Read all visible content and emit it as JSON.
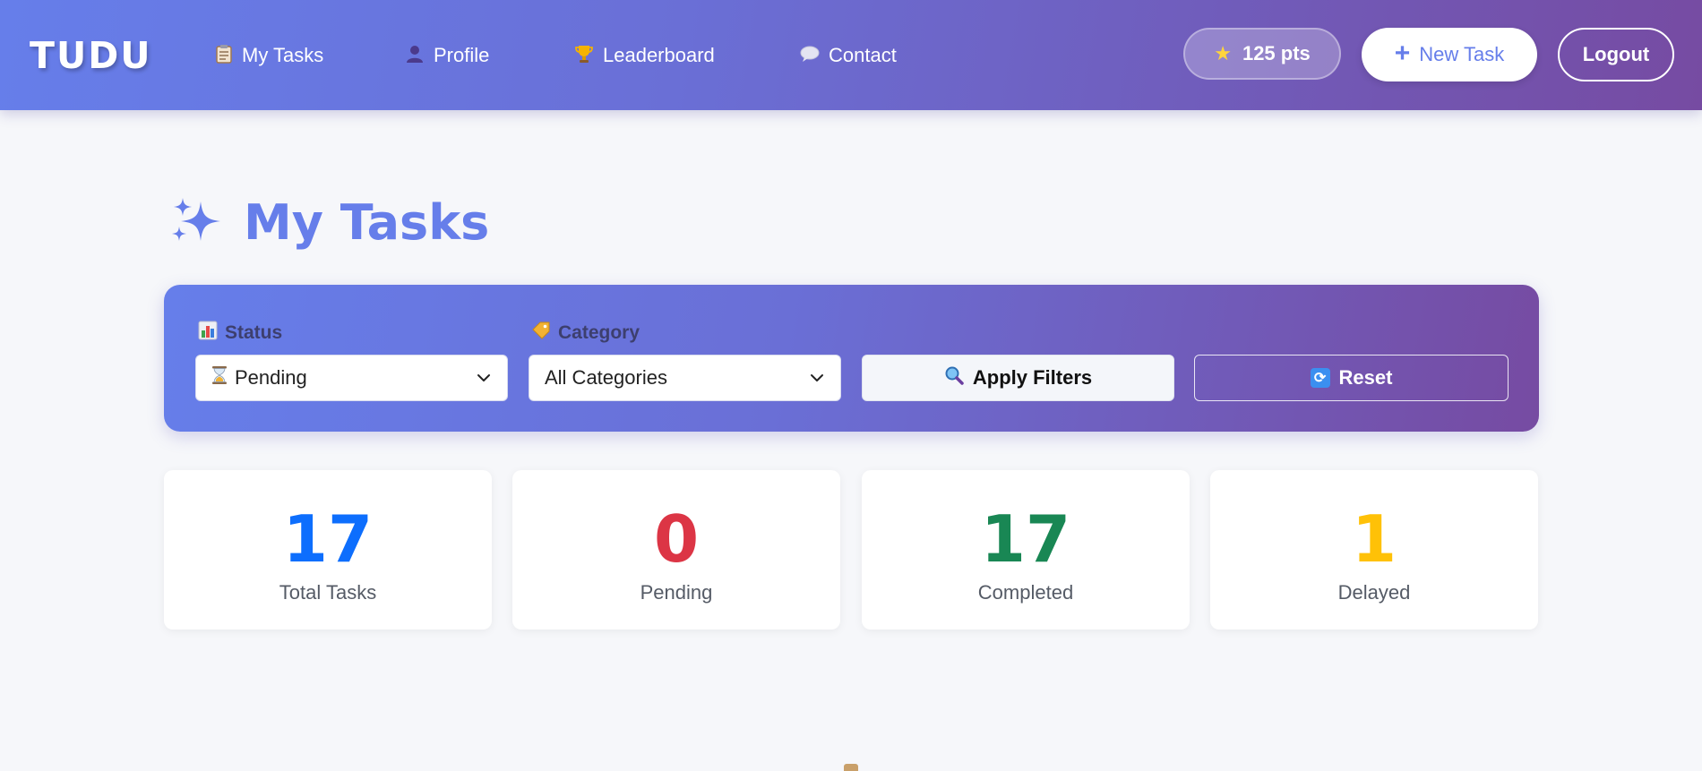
{
  "navbar": {
    "brand": "TUDU",
    "links": [
      {
        "label": "My Tasks",
        "icon": "clipboard-icon"
      },
      {
        "label": "Profile",
        "icon": "user-icon"
      },
      {
        "label": "Leaderboard",
        "icon": "trophy-icon"
      },
      {
        "label": "Contact",
        "icon": "speech-bubble-icon"
      }
    ],
    "points": "125 pts",
    "new_task_label": "New Task",
    "logout_label": "Logout"
  },
  "page": {
    "title": "My Tasks",
    "title_icon": "sparkles-icon"
  },
  "filters": {
    "status_label": "Status",
    "status_value": "Pending",
    "category_label": "Category",
    "category_value": "All Categories",
    "apply_label": "Apply Filters",
    "reset_label": "Reset"
  },
  "stats": [
    {
      "value": "17",
      "label": "Total Tasks",
      "color": "#0d6efd"
    },
    {
      "value": "0",
      "label": "Pending",
      "color": "#dc3545"
    },
    {
      "value": "17",
      "label": "Completed",
      "color": "#198754"
    },
    {
      "value": "1",
      "label": "Delayed",
      "color": "#ffc107"
    }
  ],
  "colors": {
    "brand_gradient_start": "#667eea",
    "brand_gradient_end": "#764ba2",
    "accent": "#667eea"
  }
}
